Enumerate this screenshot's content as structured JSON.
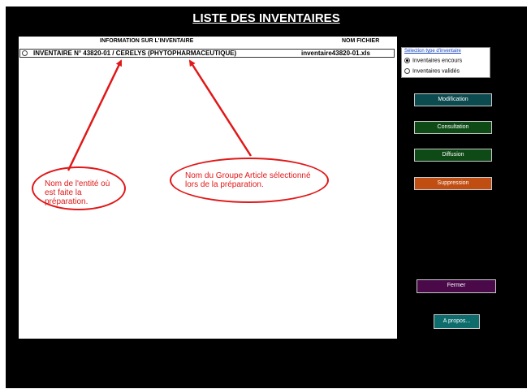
{
  "window": {
    "title": "LISTE DES INVENTAIRES"
  },
  "list": {
    "col_info": "INFORMATION SUR L'INVENTAIRE",
    "col_file": "NOM FICHIER",
    "rows": [
      {
        "info": "INVENTAIRE N° 43820-01 / CERELYS (PHYTOPHARMACEUTIQUE)",
        "file": "inventaire43820-01.xls"
      }
    ]
  },
  "annotations": {
    "entity_note": "Nom de l'entité où est faite la préparation.",
    "group_note": "Nom du Groupe Article sélectionné lors de la préparation."
  },
  "filter": {
    "title": "Sélection type d'inventaire",
    "options": [
      {
        "label": "Inventaires encours",
        "selected": true
      },
      {
        "label": "Inventaires validés",
        "selected": false
      }
    ]
  },
  "buttons": {
    "modification": "Modification",
    "consultation": "Consultation",
    "diffusion": "Diffusion",
    "suppression": "Suppression",
    "fermer": "Fermer",
    "apropos": "A propos..."
  },
  "colors": {
    "background": "#000000",
    "annotation": "#e01818",
    "modification": "#0b4a4f",
    "consultation": "#0e4a16",
    "diffusion": "#0e4a16",
    "suppression": "#c04d12",
    "fermer": "#4a0a4a",
    "apropos": "#0e6c6c"
  },
  "icons": [
    "radio-unselected-icon",
    "radio-selected-icon",
    "arrow-icon"
  ]
}
